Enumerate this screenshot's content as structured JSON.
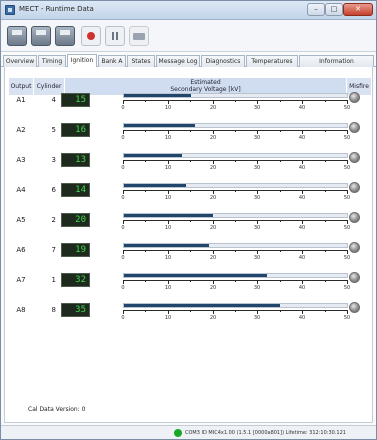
{
  "window": {
    "title": "MECT - Runtime Data"
  },
  "toolbar": {
    "buttons": [
      "save-icon",
      "open-icon",
      "export-icon",
      "record-icon",
      "stop-icon",
      "print-icon"
    ]
  },
  "tabs": [
    "Overview",
    "Timing",
    "Ignition",
    "Bank A",
    "States",
    "Message Log",
    "Diagnostics",
    "Temperatures",
    "Information"
  ],
  "active_tab": "Ignition",
  "table": {
    "headers": {
      "output": "Output",
      "cylinder": "Cylinder",
      "estimated_line1": "Estimated",
      "estimated_line2": "Secondary Voltage [kV]",
      "misfire": "Misfire"
    },
    "axis_ticks": [
      "0",
      "10",
      "20",
      "30",
      "40",
      "50"
    ],
    "axis_max": 50,
    "rows": [
      {
        "output": "A1",
        "cylinder": "4",
        "value": 15,
        "display": "15"
      },
      {
        "output": "A2",
        "cylinder": "5",
        "value": 16,
        "display": "16"
      },
      {
        "output": "A3",
        "cylinder": "3",
        "value": 13,
        "display": "13"
      },
      {
        "output": "A4",
        "cylinder": "6",
        "value": 14,
        "display": "14"
      },
      {
        "output": "A5",
        "cylinder": "2",
        "value": 20,
        "display": "20"
      },
      {
        "output": "A6",
        "cylinder": "7",
        "value": 19,
        "display": "19"
      },
      {
        "output": "A7",
        "cylinder": "1",
        "value": 32,
        "display": "32"
      },
      {
        "output": "A8",
        "cylinder": "8",
        "value": 35,
        "display": "35"
      }
    ]
  },
  "footer": {
    "cal_data": "Cal Data Version: 0"
  },
  "statusbar": {
    "connection_color": "#19a824",
    "text": "COM3  ID MIC4x1.00 (1.5.1 [0000a801])  Lifetime: 312:10:30.121"
  }
}
